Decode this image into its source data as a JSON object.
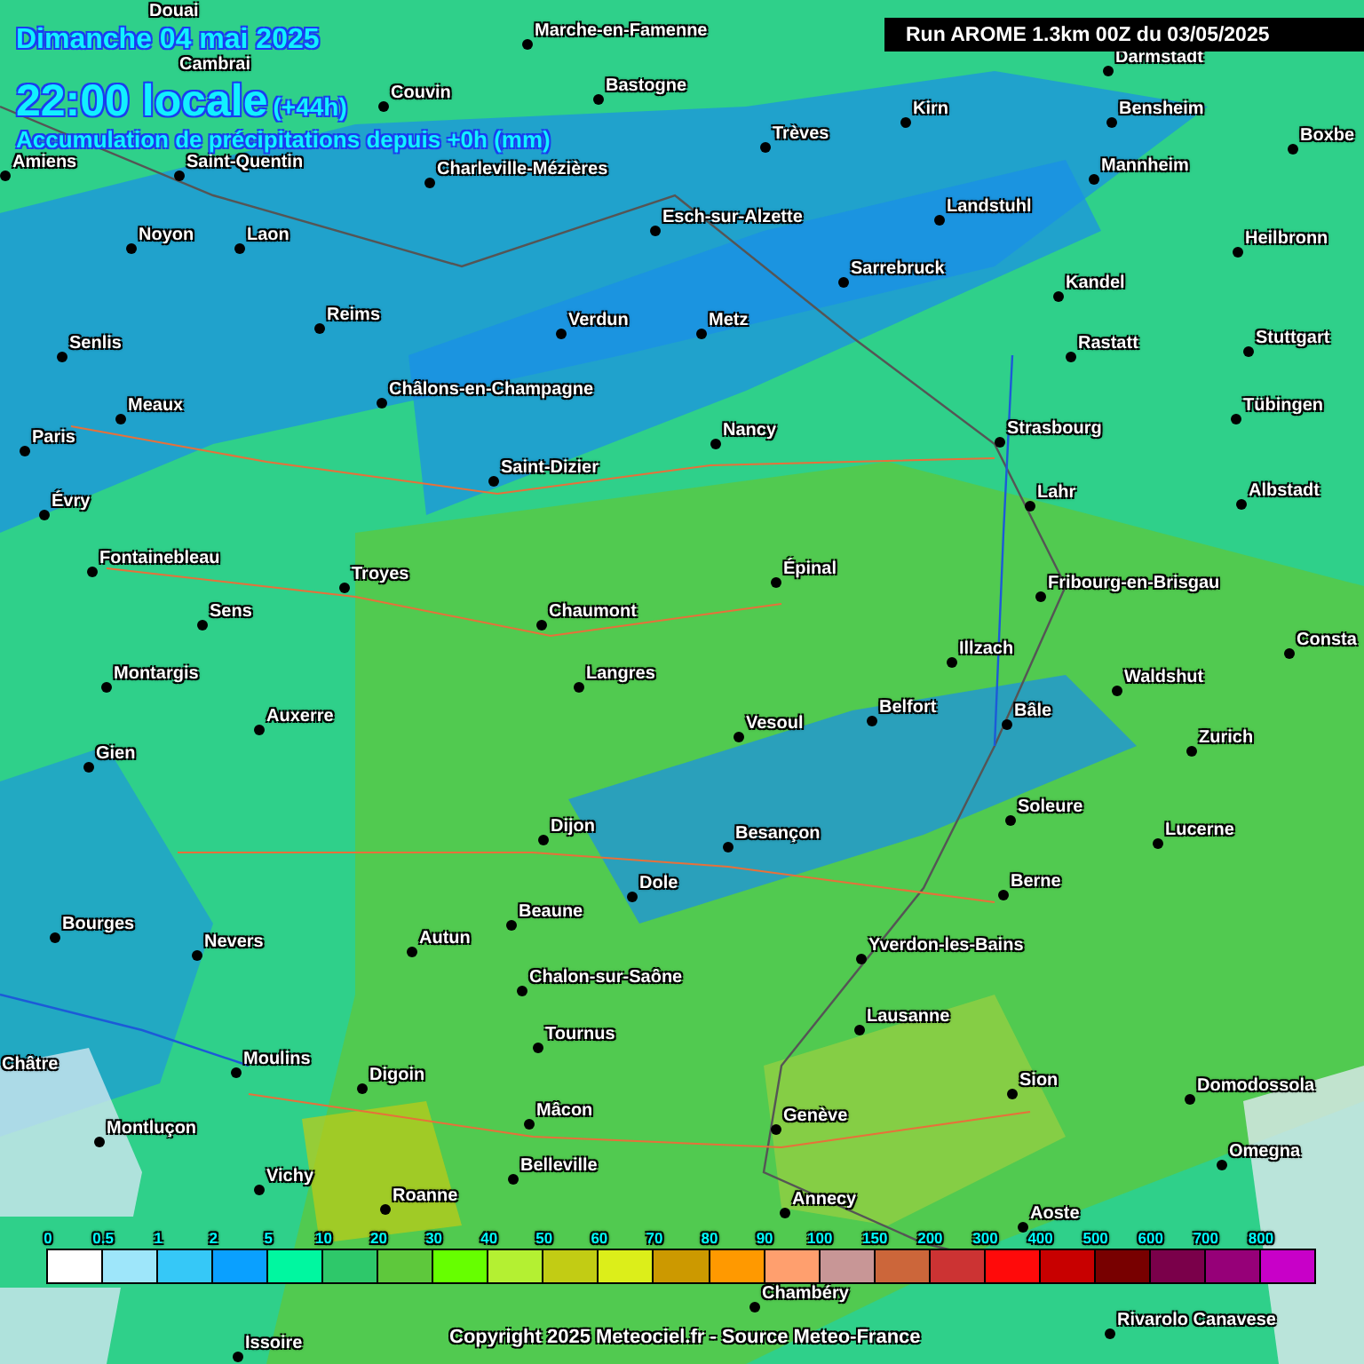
{
  "header": {
    "date": "Dimanche 04 mai 2025",
    "time": "22:00 locale",
    "lead": "(+44h)",
    "subtitle": "Accumulation de précipitations depuis +0h (mm)"
  },
  "run_label": "Run AROME 1.3km 00Z du 03/05/2025",
  "cities": [
    {
      "name": "Douai",
      "marker": false
    },
    {
      "name": "Marche-en-Famenne",
      "marker": true
    },
    {
      "name": "Cambrai",
      "marker": false
    },
    {
      "name": "Darmstadt",
      "marker": true
    },
    {
      "name": "Couvin",
      "marker": true
    },
    {
      "name": "Bastogne",
      "marker": true
    },
    {
      "name": "Kirn",
      "marker": true
    },
    {
      "name": "Bensheim",
      "marker": true
    },
    {
      "name": "Trèves",
      "marker": true
    },
    {
      "name": "Boxbe",
      "marker": true
    },
    {
      "name": "Amiens",
      "marker": true
    },
    {
      "name": "Saint-Quentin",
      "marker": true
    },
    {
      "name": "Charleville-Mézières",
      "marker": true
    },
    {
      "name": "Mannheim",
      "marker": true
    },
    {
      "name": "Noyon",
      "marker": true
    },
    {
      "name": "Laon",
      "marker": true
    },
    {
      "name": "Esch-sur-Alzette",
      "marker": true
    },
    {
      "name": "Landstuhl",
      "marker": true
    },
    {
      "name": "Heilbronn",
      "marker": true
    },
    {
      "name": "Sarrebruck",
      "marker": true
    },
    {
      "name": "Kandel",
      "marker": true
    },
    {
      "name": "Reims",
      "marker": true
    },
    {
      "name": "Verdun",
      "marker": true
    },
    {
      "name": "Metz",
      "marker": true
    },
    {
      "name": "Senlis",
      "marker": true
    },
    {
      "name": "Rastatt",
      "marker": true
    },
    {
      "name": "Stuttgart",
      "marker": true
    },
    {
      "name": "Meaux",
      "marker": true
    },
    {
      "name": "Châlons-en-Champagne",
      "marker": true
    },
    {
      "name": "Tübingen",
      "marker": true
    },
    {
      "name": "Paris",
      "marker": true
    },
    {
      "name": "Nancy",
      "marker": true
    },
    {
      "name": "Strasbourg",
      "marker": true
    },
    {
      "name": "Saint-Dizier",
      "marker": true
    },
    {
      "name": "Évry",
      "marker": true
    },
    {
      "name": "Lahr",
      "marker": true
    },
    {
      "name": "Albstadt",
      "marker": true
    },
    {
      "name": "Fontainebleau",
      "marker": true
    },
    {
      "name": "Troyes",
      "marker": true
    },
    {
      "name": "Épinal",
      "marker": true
    },
    {
      "name": "Fribourg-en-Brisgau",
      "marker": true
    },
    {
      "name": "Sens",
      "marker": true
    },
    {
      "name": "Chaumont",
      "marker": true
    },
    {
      "name": "Illzach",
      "marker": true
    },
    {
      "name": "Consta",
      "marker": true
    },
    {
      "name": "Montargis",
      "marker": true
    },
    {
      "name": "Langres",
      "marker": true
    },
    {
      "name": "Waldshut",
      "marker": true
    },
    {
      "name": "Auxerre",
      "marker": true
    },
    {
      "name": "Vesoul",
      "marker": true
    },
    {
      "name": "Belfort",
      "marker": true
    },
    {
      "name": "Bâle",
      "marker": true
    },
    {
      "name": "Gien",
      "marker": true
    },
    {
      "name": "Zurich",
      "marker": true
    },
    {
      "name": "Dijon",
      "marker": true
    },
    {
      "name": "Besançon",
      "marker": true
    },
    {
      "name": "Soleure",
      "marker": true
    },
    {
      "name": "Lucerne",
      "marker": true
    },
    {
      "name": "Dole",
      "marker": true
    },
    {
      "name": "Berne",
      "marker": true
    },
    {
      "name": "Bourges",
      "marker": true
    },
    {
      "name": "Beaune",
      "marker": true
    },
    {
      "name": "Nevers",
      "marker": true
    },
    {
      "name": "Autun",
      "marker": true
    },
    {
      "name": "Yverdon-les-Bains",
      "marker": true
    },
    {
      "name": "Chalon-sur-Saône",
      "marker": true
    },
    {
      "name": "Tournus",
      "marker": true
    },
    {
      "name": "Lausanne",
      "marker": true
    },
    {
      "name": "Châtre",
      "marker": false
    },
    {
      "name": "Moulins",
      "marker": true
    },
    {
      "name": "Digoin",
      "marker": true
    },
    {
      "name": "Sion",
      "marker": true
    },
    {
      "name": "Domodossola",
      "marker": true
    },
    {
      "name": "Montluçon",
      "marker": true
    },
    {
      "name": "Mâcon",
      "marker": true
    },
    {
      "name": "Genève",
      "marker": true
    },
    {
      "name": "Vichy",
      "marker": true
    },
    {
      "name": "Belleville",
      "marker": true
    },
    {
      "name": "Omegna",
      "marker": true
    },
    {
      "name": "Roanne",
      "marker": true
    },
    {
      "name": "Annecy",
      "marker": true
    },
    {
      "name": "Aoste",
      "marker": true
    },
    {
      "name": "Chambéry",
      "marker": true
    },
    {
      "name": "Rivarolo Canavese",
      "marker": true
    },
    {
      "name": "Issoire",
      "marker": true
    }
  ],
  "legend": [
    {
      "label": "0",
      "color": "#ffffff"
    },
    {
      "label": "0.5",
      "color": "#9ee6fa"
    },
    {
      "label": "1",
      "color": "#36c8f7"
    },
    {
      "label": "2",
      "color": "#0aa0ff"
    },
    {
      "label": "5",
      "color": "#00f7a0"
    },
    {
      "label": "10",
      "color": "#2ec86a"
    },
    {
      "label": "20",
      "color": "#5ec83c"
    },
    {
      "label": "30",
      "color": "#66ff00"
    },
    {
      "label": "40",
      "color": "#b4f032"
    },
    {
      "label": "50",
      "color": "#c2cc14"
    },
    {
      "label": "60",
      "color": "#dcee1a"
    },
    {
      "label": "70",
      "color": "#cc9900"
    },
    {
      "label": "80",
      "color": "#ff9900"
    },
    {
      "label": "90",
      "color": "#ff9f6e"
    },
    {
      "label": "100",
      "color": "#c89696"
    },
    {
      "label": "150",
      "color": "#cc663a"
    },
    {
      "label": "200",
      "color": "#cc3333"
    },
    {
      "label": "300",
      "color": "#ff0a0a"
    },
    {
      "label": "400",
      "color": "#c80000"
    },
    {
      "label": "500",
      "color": "#780000"
    },
    {
      "label": "600",
      "color": "#7a004a"
    },
    {
      "label": "700",
      "color": "#960078"
    },
    {
      "label": "800",
      "color": "#c800c8"
    }
  ],
  "copyright": "Copyright 2025 Meteociel.fr - Source Meteo-France"
}
